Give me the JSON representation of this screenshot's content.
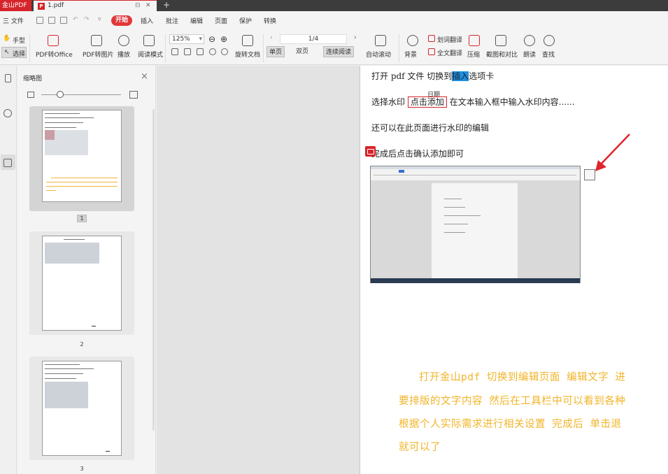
{
  "titlebar": {
    "app_name": "金山PDF",
    "doc_tab": "1.pdf",
    "new_tab": "+"
  },
  "menubar": {
    "file": "三 文件",
    "items": [
      "开始",
      "插入",
      "批注",
      "编辑",
      "页面",
      "保护",
      "转换"
    ]
  },
  "toolbar": {
    "hand": "手型",
    "select": "选择",
    "pdf_to_office": "PDF转Office",
    "pdf_to_image": "PDF转图片",
    "play": "播放",
    "read_mode": "阅读模式",
    "zoom": "125%",
    "rotate": "旋转文档",
    "page_indicator": "1/4",
    "single": "单页",
    "double": "双页",
    "continuous": "连续阅读",
    "auto_scroll": "自动滚动",
    "background": "背景",
    "word_translate": "划词翻译",
    "full_translate": "全文翻译",
    "compress": "压缩",
    "crop_compare": "截图和对比",
    "read_aloud": "朗读",
    "find": "查找"
  },
  "thumbnails": {
    "title": "缩略图",
    "pages": [
      "1",
      "2",
      "3"
    ]
  },
  "document": {
    "line1_a": "打开 pdf 文件   切换到",
    "line1_hl": "插入",
    "line1_b": "选项卡",
    "date_tag": "日期",
    "line2_a": "选择水印  ",
    "line2_box": "点击添加",
    "line2_b": "  在文本输入框中输入水印内容......",
    "line3": "还可以在此页面进行水印的编辑",
    "line4": "完成后点击确认添加即可",
    "yellow": [
      "打开金山pdf  切换到编辑页面  编辑文字  进",
      "要排版的文字内容  然后在工具栏中可以看到各种",
      "根据个人实际需求进行相关设置  完成后  单击退",
      "就可以了"
    ]
  },
  "colors": {
    "accent": "#d6242b",
    "highlight": "#1d8fe0",
    "yellow_text": "#f1b428"
  }
}
